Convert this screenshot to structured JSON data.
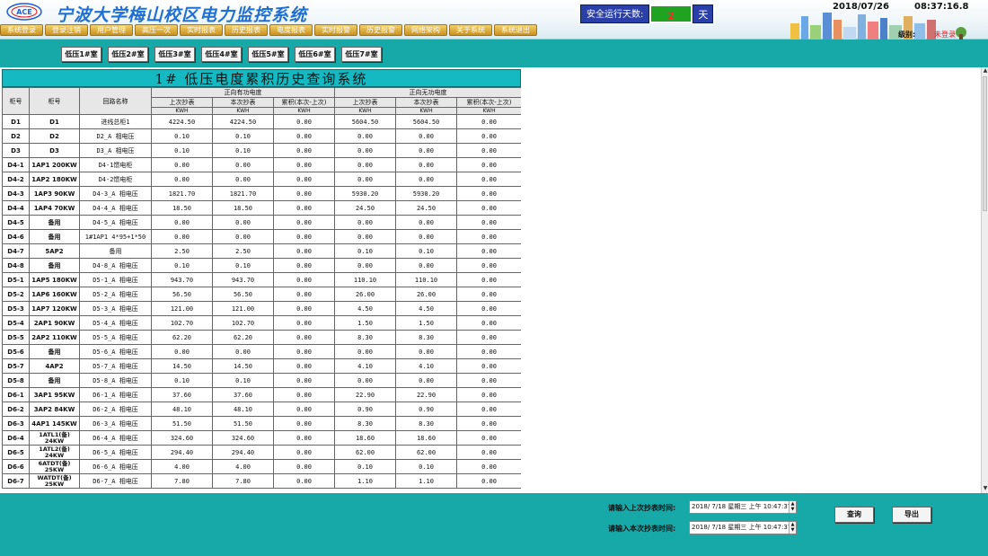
{
  "app": {
    "title": "宁波大学梅山校区电力监控系统",
    "logo_text": "ACE"
  },
  "menu": [
    "系统登录",
    "登录注销",
    "用户管理",
    "高压一次",
    "实时报表",
    "历史报表",
    "电度报表",
    "实时报警",
    "历史报警",
    "网络架构",
    "关于系统",
    "系统退出"
  ],
  "safety": {
    "label": "安全运行天数:",
    "value": "2",
    "unit": "天"
  },
  "datetime": {
    "date": "2018/07/26",
    "time": "08:37:16.8"
  },
  "user": {
    "level_label": "级别:",
    "level_value": "未登录"
  },
  "room_tabs": [
    "低压1#室",
    "低压2#室",
    "低压3#室",
    "低压4#室",
    "低压5#室",
    "低压6#室",
    "低压7#室"
  ],
  "report": {
    "title": "1# 低压电度累积历史查询系统",
    "headers": {
      "cabinet_no": "柜号",
      "cabinet_name": "柜号",
      "circuit": "回路名称",
      "group_active": "正向有功电度",
      "group_reactive": "正向无功电度",
      "last": "上次抄表",
      "current": "本次抄表",
      "accum": "累积(本次-上次)",
      "unit": "KWH"
    },
    "rows": [
      [
        "D1",
        "D1",
        "进线总柜1",
        "4224.50",
        "4224.50",
        "0.00",
        "5604.50",
        "5604.50",
        "0.00"
      ],
      [
        "D2",
        "D2",
        "D2_A 相电压",
        "0.10",
        "0.10",
        "0.00",
        "0.00",
        "0.00",
        "0.00"
      ],
      [
        "D3",
        "D3",
        "D3_A 相电压",
        "0.10",
        "0.10",
        "0.00",
        "0.00",
        "0.00",
        "0.00"
      ],
      [
        "D4-1",
        "1AP1 200KW",
        "D4-1馈电柜",
        "0.00",
        "0.00",
        "0.00",
        "0.00",
        "0.00",
        "0.00"
      ],
      [
        "D4-2",
        "1AP2 180KW",
        "D4-2馈电柜",
        "0.00",
        "0.00",
        "0.00",
        "0.00",
        "0.00",
        "0.00"
      ],
      [
        "D4-3",
        "1AP3 90KW",
        "D4-3_A 相电压",
        "1821.70",
        "1821.70",
        "0.00",
        "5930.20",
        "5930.20",
        "0.00"
      ],
      [
        "D4-4",
        "1AP4 70KW",
        "D4-4_A 相电压",
        "18.50",
        "18.50",
        "0.00",
        "24.50",
        "24.50",
        "0.00"
      ],
      [
        "D4-5",
        "备用",
        "D4-5_A 相电压",
        "0.00",
        "0.00",
        "0.00",
        "0.00",
        "0.00",
        "0.00"
      ],
      [
        "D4-6",
        "备用",
        "1#1AP1 4*95+1*50",
        "0.00",
        "0.00",
        "0.00",
        "0.00",
        "0.00",
        "0.00"
      ],
      [
        "D4-7",
        "5AP2",
        "备用",
        "2.50",
        "2.50",
        "0.00",
        "0.10",
        "0.10",
        "0.00"
      ],
      [
        "D4-8",
        "备用",
        "D4-8_A 相电压",
        "0.10",
        "0.10",
        "0.00",
        "0.00",
        "0.00",
        "0.00"
      ],
      [
        "D5-1",
        "1AP5 180KW",
        "D5-1_A 相电压",
        "943.70",
        "943.70",
        "0.00",
        "110.10",
        "110.10",
        "0.00"
      ],
      [
        "D5-2",
        "1AP6 160KW",
        "D5-2_A 相电压",
        "56.50",
        "56.50",
        "0.00",
        "26.00",
        "26.00",
        "0.00"
      ],
      [
        "D5-3",
        "1AP7 120KW",
        "D5-3_A 相电压",
        "121.00",
        "121.00",
        "0.00",
        "4.50",
        "4.50",
        "0.00"
      ],
      [
        "D5-4",
        "2AP1 90KW",
        "D5-4_A 相电压",
        "102.70",
        "102.70",
        "0.00",
        "1.50",
        "1.50",
        "0.00"
      ],
      [
        "D5-5",
        "2AP2 110KW",
        "D5-5_A 相电压",
        "62.20",
        "62.20",
        "0.00",
        "8.30",
        "8.30",
        "0.00"
      ],
      [
        "D5-6",
        "备用",
        "D5-6_A 相电压",
        "0.00",
        "0.00",
        "0.00",
        "0.00",
        "0.00",
        "0.00"
      ],
      [
        "D5-7",
        "4AP2",
        "D5-7_A 相电压",
        "14.50",
        "14.50",
        "0.00",
        "4.10",
        "4.10",
        "0.00"
      ],
      [
        "D5-8",
        "备用",
        "D5-8_A 相电压",
        "0.10",
        "0.10",
        "0.00",
        "0.00",
        "0.00",
        "0.00"
      ],
      [
        "D6-1",
        "3AP1 95KW",
        "D6-1_A 相电压",
        "37.60",
        "37.60",
        "0.00",
        "22.90",
        "22.90",
        "0.00"
      ],
      [
        "D6-2",
        "3AP2 84KW",
        "D6-2_A 相电压",
        "48.10",
        "48.10",
        "0.00",
        "0.90",
        "0.90",
        "0.00"
      ],
      [
        "D6-3",
        "4AP1 145KW",
        "D6-3_A 相电压",
        "51.50",
        "51.50",
        "0.00",
        "8.30",
        "8.30",
        "0.00"
      ],
      [
        "D6-4",
        "1ATL1(备) 24KW",
        "D6-4_A 相电压",
        "324.60",
        "324.60",
        "0.00",
        "18.60",
        "18.60",
        "0.00"
      ],
      [
        "D6-5",
        "1ATL2(备) 24KW",
        "D6-5_A 相电压",
        "294.40",
        "294.40",
        "0.00",
        "62.00",
        "62.00",
        "0.00"
      ],
      [
        "D6-6",
        "6ATDT(备) 25KW",
        "D6-6_A 相电压",
        "4.00",
        "4.00",
        "0.00",
        "0.10",
        "0.10",
        "0.00"
      ],
      [
        "D6-7",
        "WATDT(备) 25KW",
        "D6-7_A 相电压",
        "7.80",
        "7.80",
        "0.00",
        "1.10",
        "1.10",
        "0.00"
      ]
    ]
  },
  "query": {
    "last_label": "请输入上次抄表时间:",
    "last_value": "2018/ 7/18 星期三  上午 10:47:37",
    "current_label": "请输入本次抄表时间:",
    "current_value": "2018/ 7/18 星期三  上午 10:47:37",
    "query_button": "查询",
    "export_button": "导出"
  },
  "colors": {
    "background": "#17a9a8",
    "title_bar": "#14b9c2",
    "menu": "#d9a532",
    "safe_value": "#1fa320",
    "alert_text": "#e0141e"
  }
}
